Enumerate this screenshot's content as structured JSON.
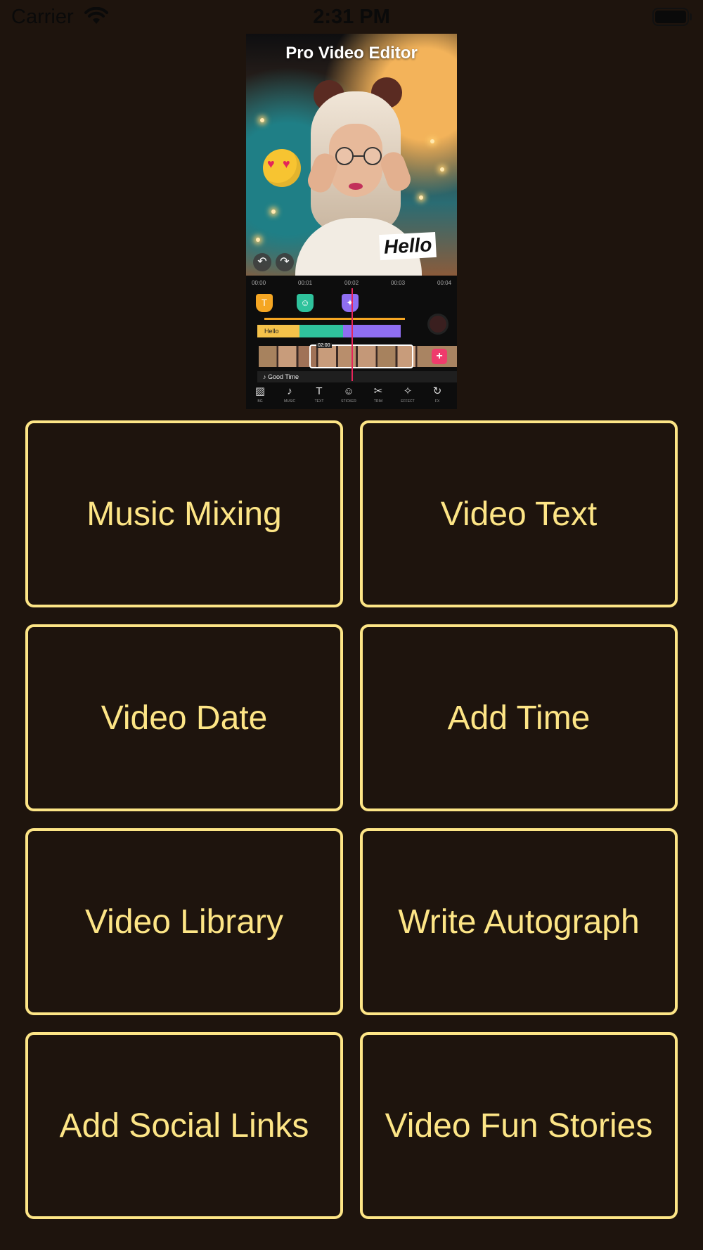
{
  "status_bar": {
    "carrier": "Carrier",
    "time": "2:31 PM",
    "wifi_icon": "wifi-icon",
    "battery_icon": "battery-icon"
  },
  "banner": {
    "title": "Pro Video Editor",
    "sticker_text": "Hello",
    "timeline": {
      "ruler": [
        "00:00",
        "00:01",
        "00:02",
        "00:03",
        "00:04"
      ],
      "text_track_label": "Hello",
      "clip_time": "02:00",
      "audio_label": "Good Time",
      "tools": [
        "BG",
        "MUSIC",
        "TEXT",
        "STICKER",
        "TRIM",
        "EFFECT",
        "FX"
      ]
    },
    "colors": {
      "marker_text": "#f5a623",
      "marker_sticker": "#2fc29c",
      "marker_effect": "#8f6ef2",
      "playhead": "#e7245a"
    }
  },
  "features": [
    {
      "label": "Music Mixing"
    },
    {
      "label": "Video Text"
    },
    {
      "label": "Video Date"
    },
    {
      "label": "Add Time"
    },
    {
      "label": "Video Library"
    },
    {
      "label": "Write Autograph"
    },
    {
      "label": "Add Social Links"
    },
    {
      "label": "Video Fun Stories"
    }
  ],
  "theme": {
    "background": "#1e140d",
    "accent": "#fde586"
  }
}
